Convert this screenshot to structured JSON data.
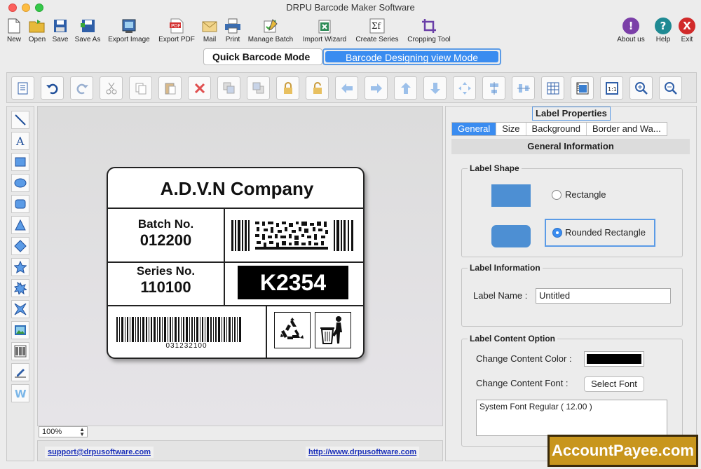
{
  "window": {
    "title": "DRPU Barcode Maker Software"
  },
  "toolbar": {
    "items": [
      {
        "label": "New",
        "icon": "new-file-icon"
      },
      {
        "label": "Open",
        "icon": "open-folder-icon"
      },
      {
        "label": "Save",
        "icon": "save-icon"
      },
      {
        "label": "Save As",
        "icon": "save-as-icon"
      },
      {
        "label": "Export Image",
        "icon": "export-image-icon"
      },
      {
        "label": "Export PDF",
        "icon": "export-pdf-icon"
      },
      {
        "label": "Mail",
        "icon": "mail-icon"
      },
      {
        "label": "Print",
        "icon": "print-icon"
      },
      {
        "label": "Manage Batch",
        "icon": "manage-batch-icon"
      },
      {
        "label": "Import Wizard",
        "icon": "import-wizard-icon"
      },
      {
        "label": "Create Series",
        "icon": "create-series-icon"
      },
      {
        "label": "Cropping Tool",
        "icon": "crop-icon"
      }
    ],
    "right": [
      {
        "label": "About us",
        "glyph": "!",
        "color": "#7b3fa8"
      },
      {
        "label": "Help",
        "glyph": "?",
        "color": "#1f8a93"
      },
      {
        "label": "Exit",
        "glyph": "X",
        "color": "#d12a2a"
      }
    ]
  },
  "modes": {
    "quick": "Quick Barcode Mode",
    "design": "Barcode Designing view Mode"
  },
  "label": {
    "company": "A.D.V.N Company",
    "batch_key": "Batch No.",
    "batch_value": "012200",
    "series_key": "Series No.",
    "series_value": "110100",
    "code": "K2354",
    "barcode_number": "031232100"
  },
  "zoom": "100%",
  "footer": {
    "email": "support@drpusoftware.com",
    "url": "http://www.drpusoftware.com"
  },
  "properties": {
    "title": "Label Properties",
    "tabs": [
      "General",
      "Size",
      "Background",
      "Border and Wa..."
    ],
    "section": "General Information",
    "shape_group": "Label Shape",
    "rectangle": "Rectangle",
    "rounded": "Rounded Rectangle",
    "info_group": "Label Information",
    "name_label": "Label Name :",
    "name_value": "Untitled",
    "content_group": "Label Content Option",
    "color_label": "Change Content Color :",
    "font_label": "Change Content Font :",
    "select_font": "Select Font",
    "font_value": "System Font Regular ( 12.00 )",
    "content_color": "#000000"
  },
  "watermark": "AccountPayee.com"
}
